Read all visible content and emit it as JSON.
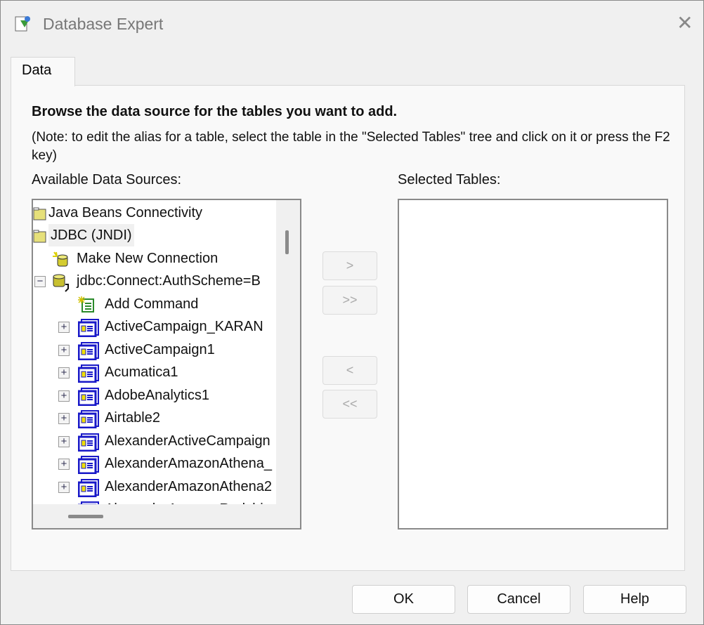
{
  "window": {
    "title": "Database Expert",
    "close_icon": "close-icon",
    "app_icon": "database-expert-icon"
  },
  "tabs": [
    {
      "label": "Data"
    }
  ],
  "heading": "Browse the data source for the tables you want to add.",
  "note": "(Note: to edit the alias for a table, select the table in the \"Selected Tables\" tree and click on it or press the F2 key)",
  "available_label": "Available Data Sources:",
  "selected_label": "Selected Tables:",
  "tree": [
    {
      "label": "Java Beans Connectivity",
      "icon": "folder-icon",
      "level": 0
    },
    {
      "label": "JDBC (JNDI)",
      "icon": "folder-icon",
      "level": 0,
      "highlighted": true
    },
    {
      "label": "Make New Connection",
      "icon": "new-connection-icon",
      "level": 1
    },
    {
      "label": "jdbc:Connect:AuthScheme=B",
      "icon": "connection-icon",
      "level": 1,
      "expander": "minus"
    },
    {
      "label": "Add Command",
      "icon": "add-command-icon",
      "level": 2
    },
    {
      "label": "ActiveCampaign_KARAN",
      "icon": "database-icon",
      "level": 2,
      "expander": "plus"
    },
    {
      "label": "ActiveCampaign1",
      "icon": "database-icon",
      "level": 2,
      "expander": "plus"
    },
    {
      "label": "Acumatica1",
      "icon": "database-icon",
      "level": 2,
      "expander": "plus"
    },
    {
      "label": "AdobeAnalytics1",
      "icon": "database-icon",
      "level": 2,
      "expander": "plus"
    },
    {
      "label": "Airtable2",
      "icon": "database-icon",
      "level": 2,
      "expander": "plus"
    },
    {
      "label": "AlexanderActiveCampaign",
      "icon": "database-icon",
      "level": 2,
      "expander": "plus"
    },
    {
      "label": "AlexanderAmazonAthena_",
      "icon": "database-icon",
      "level": 2,
      "expander": "plus"
    },
    {
      "label": "AlexanderAmazonAthena2",
      "icon": "database-icon",
      "level": 2,
      "expander": "plus"
    },
    {
      "label": "AlexanderAmazonRedshi",
      "icon": "database-icon",
      "level": 2,
      "expander": "plus"
    }
  ],
  "transfer_buttons": [
    {
      "label": ">"
    },
    {
      "label": ">>"
    },
    {
      "label": "<"
    },
    {
      "label": "<<"
    }
  ],
  "buttons": {
    "ok": "OK",
    "cancel": "Cancel",
    "help": "Help"
  }
}
